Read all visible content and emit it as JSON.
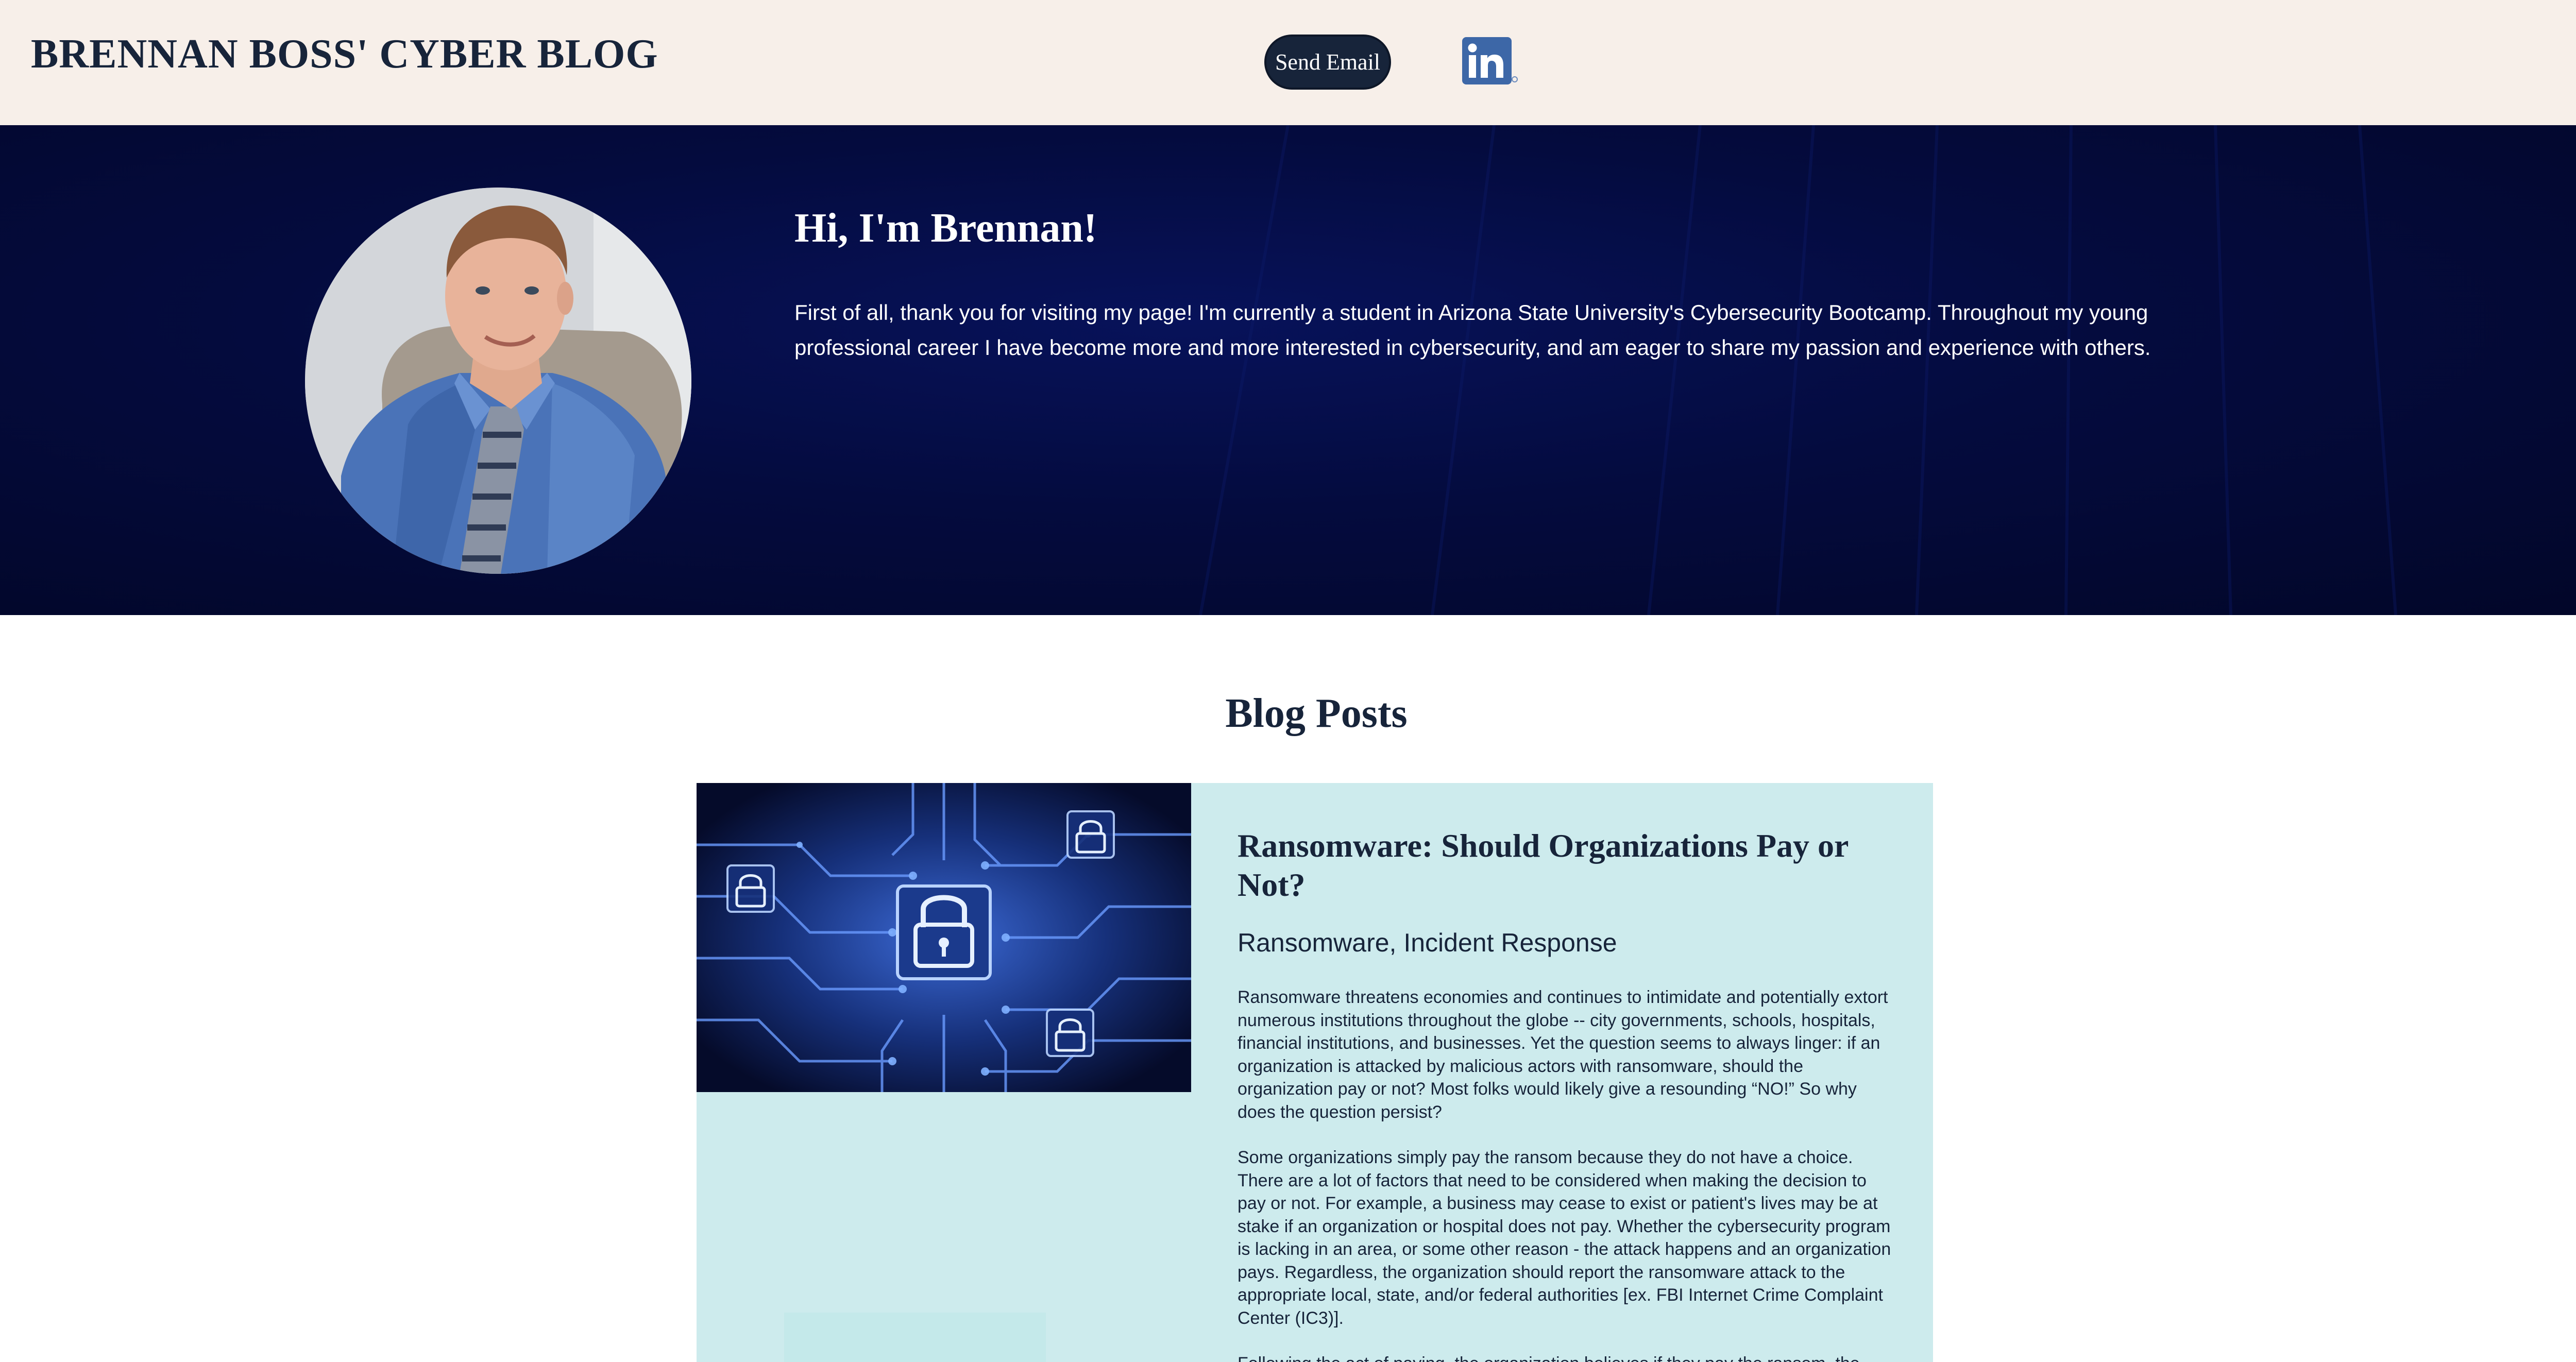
{
  "header": {
    "site_title": "BRENNAN BOSS' CYBER BLOG",
    "send_email_label": "Send Email",
    "linkedin_icon": "linkedin-icon",
    "background": "#f7efe9",
    "title_color": "#17243a"
  },
  "hero": {
    "heading": "Hi, I'm Brennan!",
    "intro": "First of all, thank you for visiting my page! I'm currently a student in Arizona State University's Cybersecurity Bootcamp. Throughout my young professional career I have become more and more interested in cybersecurity, and am eager to share my passion and experience with others.",
    "background": "#040b3e"
  },
  "blog": {
    "section_title": "Blog Posts",
    "posts": [
      {
        "title": "Ransomware: Should Organizations Pay or Not?",
        "tags": "Ransomware, Incident Response",
        "paragraphs": [
          "Ransomware threatens economies and continues to intimidate and potentially extort numerous institutions throughout the globe -- city governments, schools, hospitals, financial institutions, and businesses. Yet the question seems to always linger: if an organization is attacked by malicious actors with ransomware, should the organization pay or not? Most folks would likely give a resounding “NO!” So why does the question persist?",
          "Some organizations simply pay the ransom because they do not have a choice. There are a lot of factors that need to be considered when making the decision to pay or not. For example, a business may cease to exist or patient's lives may be at stake if an organization or hospital does not pay. Whether the cybersecurity program is lacking in an area, or some other reason - the attack happens and an organization pays. Regardless, the organization should report the ransomware attack to the appropriate local, state, and/or federal authorities [ex. FBI Internet Crime Complaint Center (IC3)].",
          "Following the act of paying, the organization believes if they pay the ransom, the"
        ],
        "card_color": "#cdebed"
      }
    ]
  }
}
